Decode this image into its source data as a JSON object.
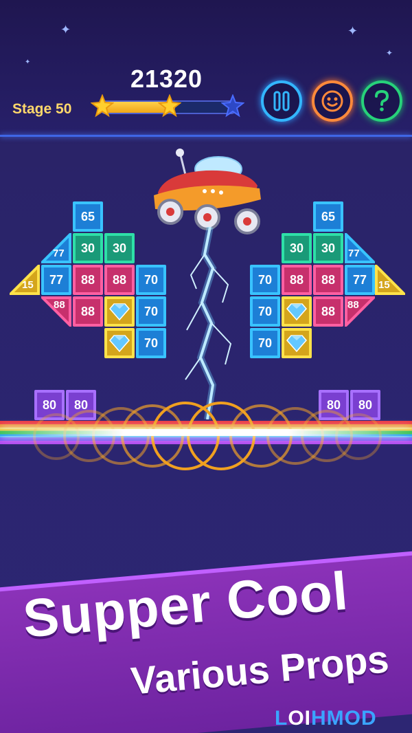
{
  "hud": {
    "score": "21320",
    "stage_label": "Stage 50",
    "progress_fraction": 0.55,
    "progress_stars_earned": 2,
    "progress_stars_total": 3
  },
  "buttons": {
    "pause_icon": "pause-icon",
    "face_icon": "smiley-face-icon",
    "help_icon": "question-mark-icon"
  },
  "board": {
    "left": {
      "row1": [
        "65"
      ],
      "row2": [
        "77",
        "30",
        "30"
      ],
      "row3": [
        "15",
        "77",
        "88",
        "88",
        "70"
      ],
      "row4": [
        "88",
        "88",
        "diamond",
        "70"
      ],
      "row5": [
        "diamond",
        "70"
      ]
    },
    "right": {
      "row1": [
        "65"
      ],
      "row2": [
        "30",
        "30",
        "77"
      ],
      "row3": [
        "70",
        "88",
        "88",
        "77",
        "15"
      ],
      "row4": [
        "70",
        "diamond",
        "88",
        "88"
      ],
      "row5": [
        "70",
        "diamond"
      ]
    },
    "purple_left": [
      "80",
      "80"
    ],
    "purple_right": [
      "80",
      "80"
    ]
  },
  "banner": {
    "line1": "Supper Cool",
    "line2": "Various Props"
  },
  "watermark": {
    "part1": "L",
    "part2": "OI",
    "part3": "HMOD"
  },
  "colors": {
    "background": "#2c2470",
    "brick_blue": "#1d7fd6",
    "brick_green": "#1a9a78",
    "brick_pink": "#c7306c",
    "brick_yellow": "#d4a51c",
    "brick_purple": "#7a3fd0",
    "banner": "#8b32b8"
  }
}
